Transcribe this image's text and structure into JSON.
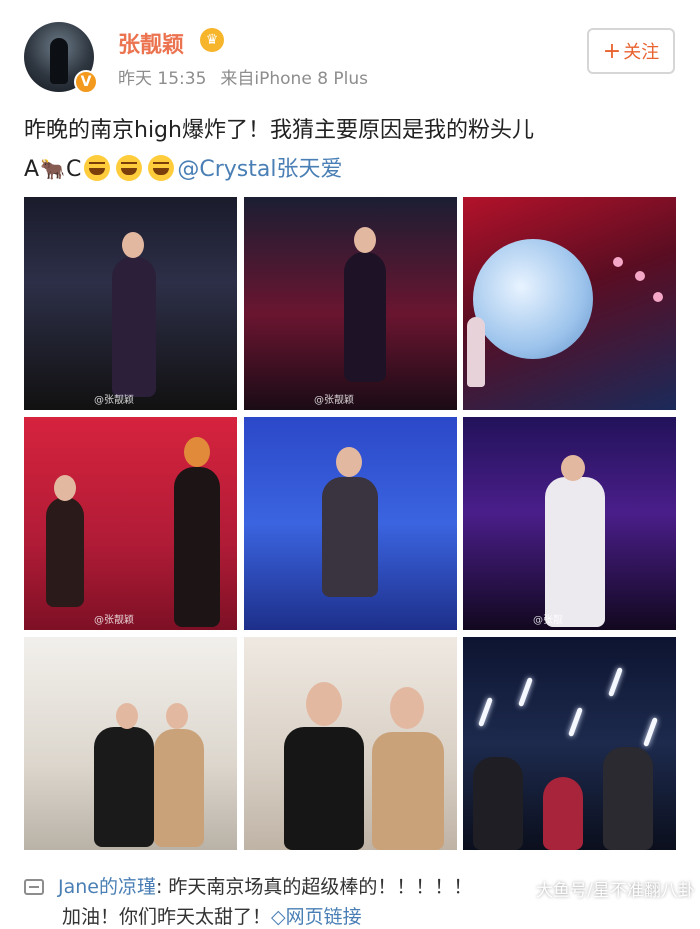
{
  "user": {
    "name": "张靓颖",
    "verified_badge": "V",
    "crown_glyph": "♛",
    "time": "昨天 15:35",
    "source": "来自iPhone 8 Plus"
  },
  "follow": {
    "plus": "+",
    "label": "关注"
  },
  "post": {
    "text": "昨晚的南京high爆炸了！我猜主要原因是我的粉头儿",
    "line2_a": "A",
    "line2_c": "C",
    "mention": "@Crystal张天爱"
  },
  "photos": [
    {
      "watermark": "@张靓颖"
    },
    {
      "watermark": "@张靓颖"
    },
    {
      "watermark": ""
    },
    {
      "watermark": "@张靓颖"
    },
    {
      "watermark": ""
    },
    {
      "watermark": "@张靓"
    },
    {
      "watermark": ""
    },
    {
      "watermark": ""
    },
    {
      "watermark": ""
    }
  ],
  "comment": {
    "name": "Jane的凉瑾",
    "text": ": 昨天南京场真的超级棒的！！！！！",
    "line2": "加油！你们昨天太甜了！",
    "link": "◇网页链接"
  },
  "watermark": "大鱼号/星不准翻八卦"
}
